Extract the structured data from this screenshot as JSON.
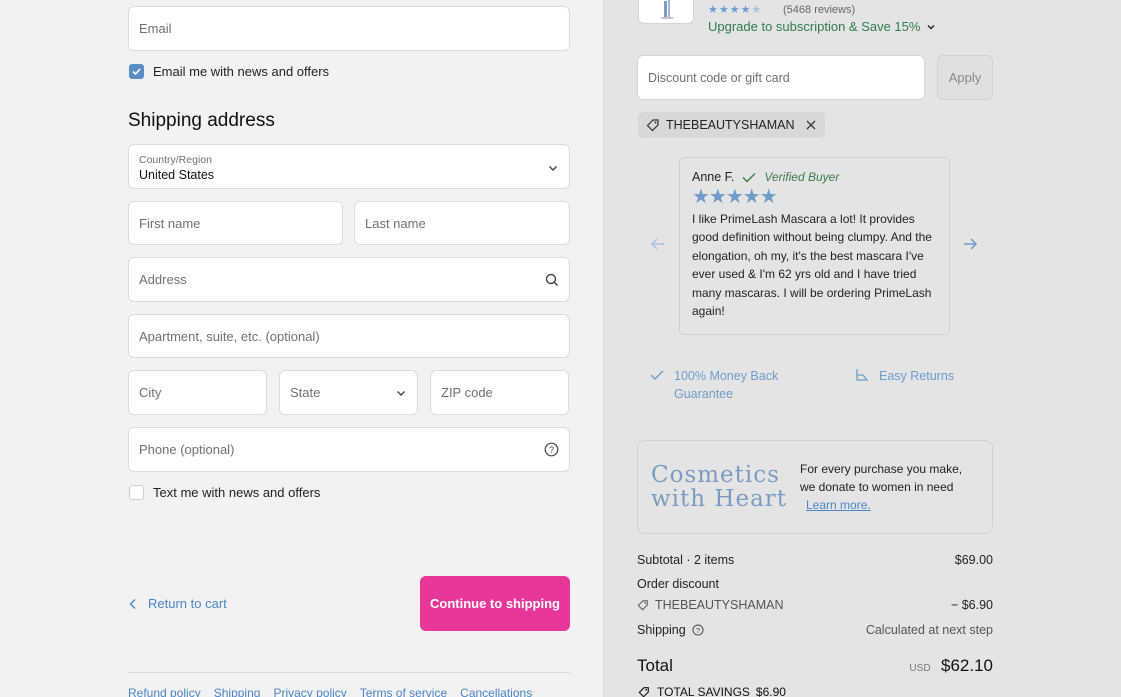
{
  "contact": {
    "email_placeholder": "Email",
    "email_news_label": "Email me with news and offers",
    "email_news_checked": true
  },
  "shipping": {
    "heading": "Shipping address",
    "country_label": "Country/Region",
    "country_value": "United States",
    "first_name_placeholder": "First name",
    "last_name_placeholder": "Last name",
    "address_placeholder": "Address",
    "apartment_placeholder": "Apartment, suite, etc. (optional)",
    "city_placeholder": "City",
    "state_placeholder": "State",
    "zip_placeholder": "ZIP code",
    "phone_placeholder": "Phone (optional)",
    "text_news_label": "Text me with news and offers",
    "text_news_checked": false
  },
  "actions": {
    "return_label": "Return to cart",
    "continue_label": "Continue to shipping"
  },
  "footer": {
    "links": [
      "Refund policy",
      "Shipping",
      "Privacy policy",
      "Terms of service",
      "Cancellations"
    ]
  },
  "product": {
    "rating": 4.5,
    "reviews_text": "(5468 reviews)",
    "upgrade_text": "Upgrade to subscription & Save 15%"
  },
  "discount": {
    "placeholder": "Discount code or gift card",
    "apply_label": "Apply",
    "applied_code": "THEBEAUTYSHAMAN"
  },
  "review": {
    "name": "Anne F.",
    "verified": "Verified Buyer",
    "stars": 5,
    "text": "I like PrimeLash Mascara a lot! It provides good definition without being clumpy. And the elongation, oh my, it's the best mascara I've ever used & I'm 62 yrs old and I have tried many mascaras. I will be ordering PrimeLash again!"
  },
  "guarantees": {
    "money_back_line1": "100% Money Back",
    "money_back_line2": "Guarantee",
    "easy_returns": "Easy Returns"
  },
  "cosmetics": {
    "title_line1": "Cosmetics",
    "title_line2": "with Heart",
    "text": "For every purchase you make, we donate to women in need",
    "learn_more": "Learn more."
  },
  "summary": {
    "subtotal_label": "Subtotal · 2 items",
    "subtotal_value": "$69.00",
    "order_discount_label": "Order discount",
    "discount_code": "THEBEAUTYSHAMAN",
    "discount_value": "− $6.90",
    "shipping_label": "Shipping",
    "shipping_value": "Calculated at next step",
    "total_label": "Total",
    "currency": "USD",
    "total_value": "$62.10",
    "savings_label": "TOTAL SAVINGS",
    "savings_value": "$6.90"
  },
  "colors": {
    "accent_button": "#e8379a",
    "link": "#4a86c5",
    "star": "#6e9dcb",
    "verified": "#3d7a4a"
  }
}
